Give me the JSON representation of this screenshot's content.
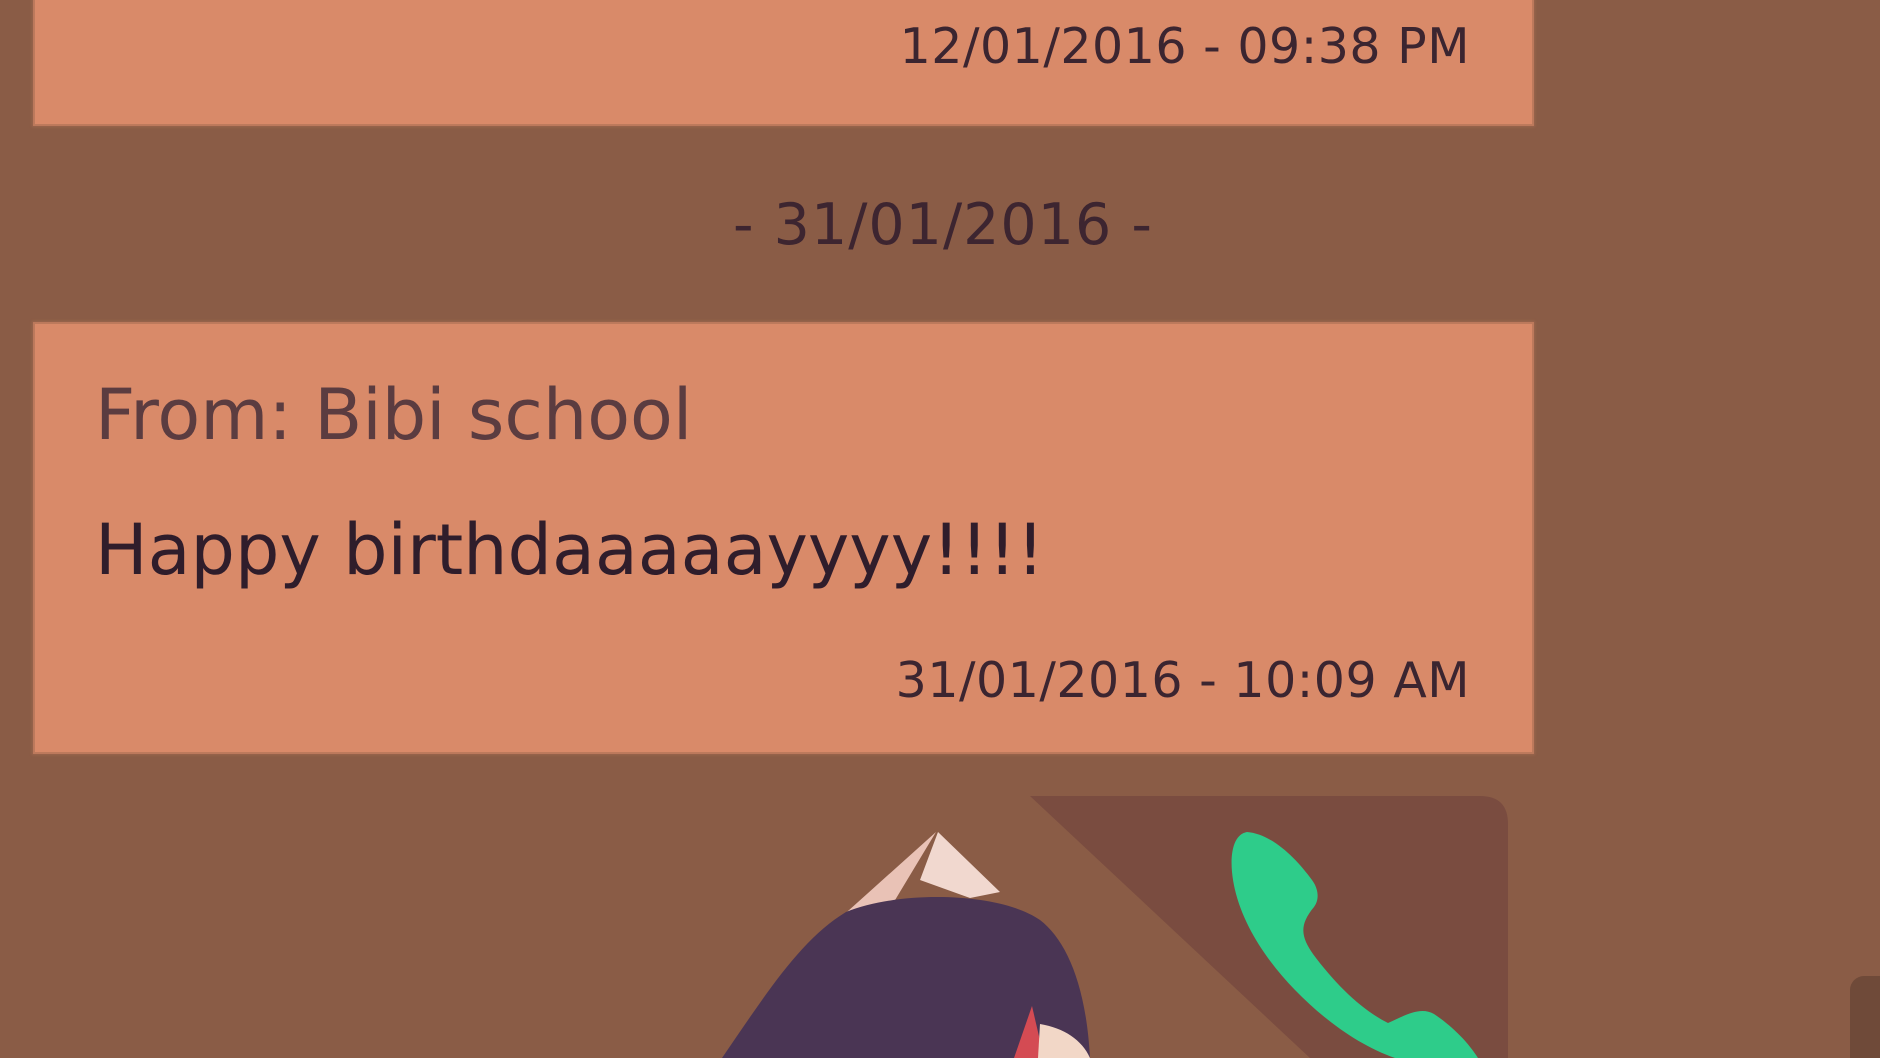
{
  "messages": [
    {
      "timestamp": "12/01/2016 - 09:38 PM"
    },
    {
      "sender": "From: Bibi school",
      "text": "Happy birthdaaaaayyyy!!!!",
      "timestamp": "31/01/2016 - 10:09 AM"
    }
  ],
  "date_separator": "- 31/01/2016 -",
  "icons": {
    "call": "phone-icon",
    "avatar": "character-portrait"
  },
  "colors": {
    "background": "#8a5c46",
    "bubble": "#d98a69",
    "call_accent": "#2ecc8a"
  }
}
